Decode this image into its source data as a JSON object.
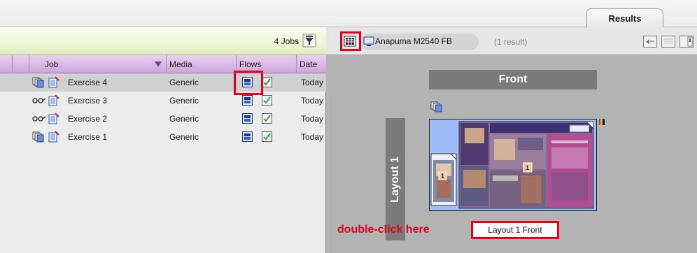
{
  "tabs": {
    "results": "Results"
  },
  "jobs_panel": {
    "count_label": "4 Jobs",
    "columns": [
      "Job",
      "Media",
      "Flows",
      "Date"
    ],
    "rows": [
      {
        "name": "Exercise 4",
        "media": "Generic",
        "date": "Today",
        "selected": true
      },
      {
        "name": "Exercise 3",
        "media": "Generic",
        "date": "Today",
        "selected": false
      },
      {
        "name": "Exercise 2",
        "media": "Generic",
        "date": "Today",
        "selected": false
      },
      {
        "name": "Exercise 1",
        "media": "Generic",
        "date": "Today",
        "selected": false
      }
    ]
  },
  "results_panel": {
    "device": "Anapuma M2540 FB",
    "result_count": "(1 result)",
    "side": "Front",
    "layout_name": "Layout 1",
    "page_number": "1",
    "layout_label": "Layout 1 Front",
    "annotation": "double-click here"
  },
  "colors": {
    "jobs_header": "#dfeec1",
    "column_header": "#cda5dc",
    "annotation_red": "#e3001b",
    "sheet_blue": "#9fbdf8"
  },
  "icons": [
    "filter-icon",
    "layers-stack-icon",
    "job-document-icon",
    "flow-link-icon",
    "flow-blue-icon",
    "flow-green-check-icon",
    "layout-grid-icon",
    "monitor-icon",
    "color-bar-icon"
  ]
}
